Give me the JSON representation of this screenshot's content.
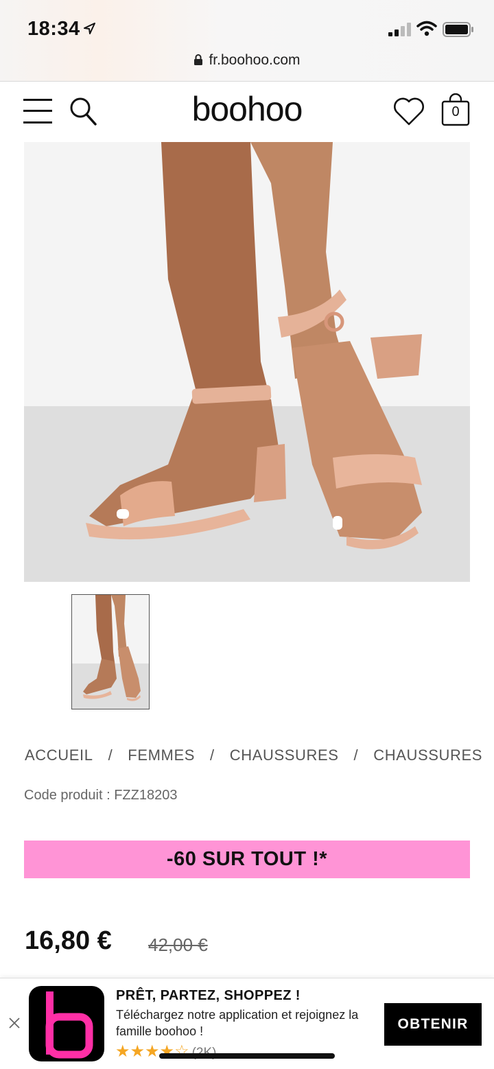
{
  "status_bar": {
    "time": "18:34",
    "url": "fr.boohoo.com"
  },
  "header": {
    "logo": "boohoo",
    "bag_count": "0",
    "icons": [
      "menu-icon",
      "search-icon",
      "heart-icon",
      "bag-icon"
    ]
  },
  "product": {
    "breadcrumb": [
      "ACCUEIL",
      "FEMMES",
      "CHAUSSURES",
      "CHAUSSURES"
    ],
    "breadcrumb_separator": "/",
    "code_label": "Code produit : ",
    "code_value": "FZZ18203",
    "promo_text": "-60 SUR TOUT !*",
    "promo_color": "#ff94d6",
    "price": "16,80 €",
    "old_price": "42,00 €"
  },
  "app_banner": {
    "title": "PRÊT, PARTEZ, SHOPPEZ !",
    "text": "Téléchargez notre application et rejoignez la famille boohoo !",
    "stars": "★★★★☆",
    "rating_count": "(2K)",
    "button": "OBTENIR",
    "brand_accent": "#ff2fa6"
  }
}
